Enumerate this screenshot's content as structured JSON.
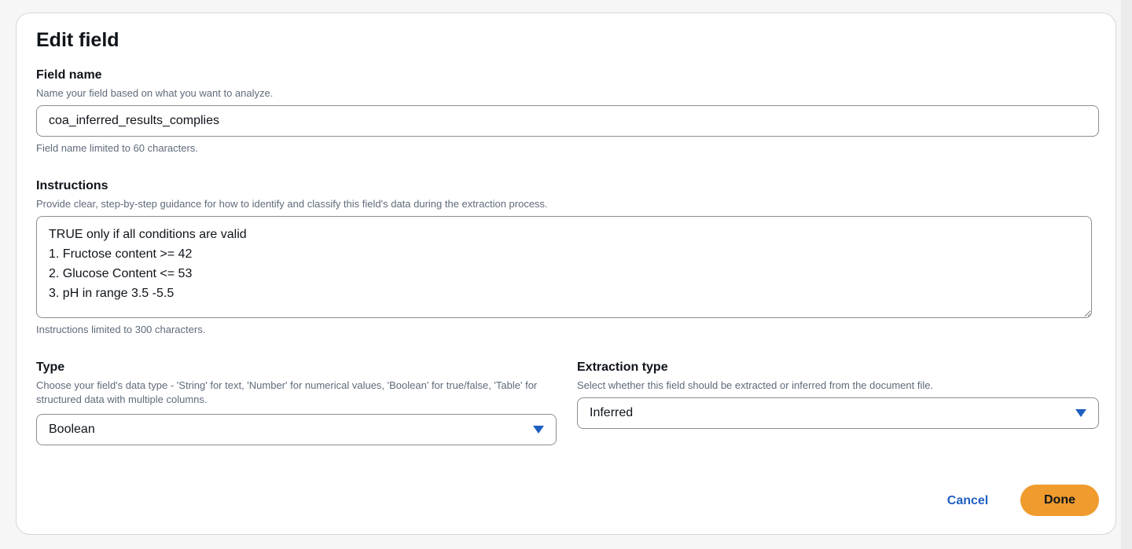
{
  "dialog": {
    "title": "Edit field"
  },
  "field_name": {
    "label": "Field name",
    "description": "Name your field based on what you want to analyze.",
    "value": "coa_inferred_results_complies",
    "hint": "Field name limited to 60 characters."
  },
  "instructions": {
    "label": "Instructions",
    "description": "Provide clear, step-by-step guidance for how to identify and classify this field's data during the extraction process.",
    "value": "TRUE only if all conditions are valid\n1. Fructose content >= 42\n2. Glucose Content <= 53\n3. pH in range 3.5 -5.5",
    "hint": "Instructions limited to 300 characters."
  },
  "type": {
    "label": "Type",
    "description": "Choose your field's data type - 'String' for text, 'Number' for numerical values, 'Boolean' for true/false, 'Table' for structured data with multiple columns.",
    "value": "Boolean",
    "icon": "caret-down-icon"
  },
  "extraction_type": {
    "label": "Extraction type",
    "description": "Select whether this field should be extracted or inferred from the document file.",
    "value": "Inferred",
    "icon": "caret-down-icon"
  },
  "actions": {
    "cancel_label": "Cancel",
    "done_label": "Done"
  },
  "colors": {
    "primary_button": "#ef9b2e",
    "link": "#1f5fbf",
    "border": "#8c8c94",
    "text": "#0f141a",
    "secondary_text": "#5f6b7a"
  }
}
